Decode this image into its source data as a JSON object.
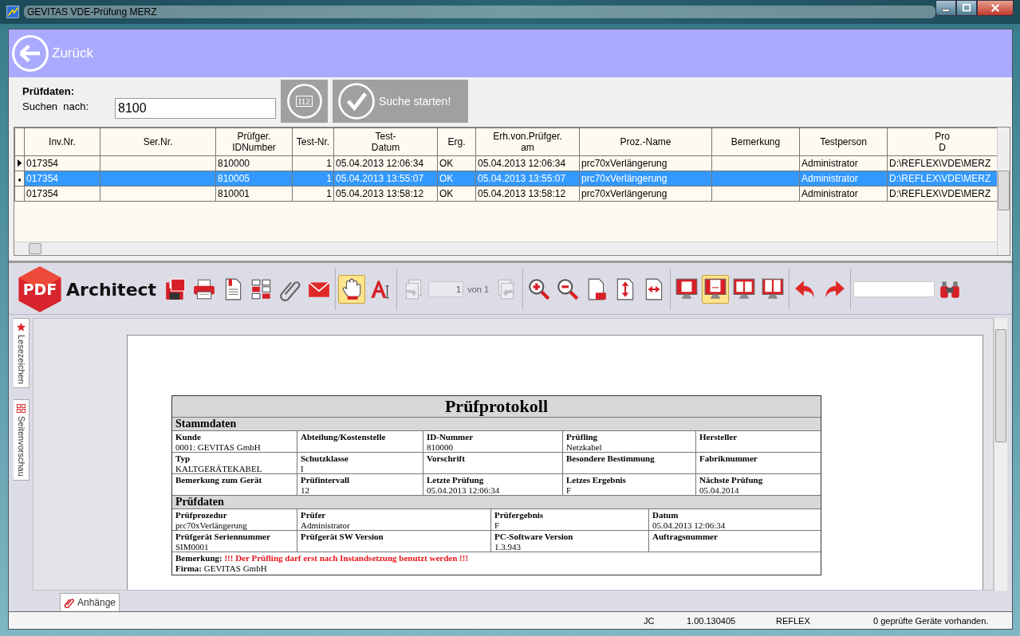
{
  "window": {
    "title": "GEVITAS VDE-Prüfung MERZ"
  },
  "header": {
    "back_label": "Zurück"
  },
  "search": {
    "heading": "Prüfdaten:",
    "label": "Suchen  nach:",
    "value": "8100",
    "id_card_text": "I12",
    "start_label": "Suche starten!"
  },
  "table": {
    "columns": [
      "Inv.Nr.",
      "Ser.Nr.",
      "Prüfger.\nIDNumber",
      "Test-Nr.",
      "Test-\nDatum",
      "Erg.",
      "Erh.von.Prüfger.\nam",
      "Proz.-Name",
      "Bemerkung",
      "Testperson",
      "Pro\nD"
    ],
    "rows": [
      {
        "kind": "current",
        "selected": false,
        "cells": [
          "017354",
          null,
          "810000",
          "1",
          "05.04.2013 12:06:34",
          "OK",
          "05.04.2013 12:06:34",
          "prc70xVerlängerung",
          null,
          "Administrator",
          "D:\\REFLEX\\VDE\\MERZ"
        ]
      },
      {
        "kind": "edited",
        "selected": true,
        "cells": [
          "017354",
          null,
          "810005",
          "1",
          "05.04.2013 13:55:07",
          "OK",
          "05.04.2013 13:55:07",
          "prc70xVerlängerung",
          null,
          "Administrator",
          "D:\\REFLEX\\VDE\\MERZ"
        ]
      },
      {
        "kind": "plain",
        "selected": false,
        "cells": [
          "017354",
          null,
          "810001",
          "1",
          "05.04.2013 13:58:12",
          "OK",
          "05.04.2013 13:58:12",
          "prc70xVerlängerung",
          null,
          "Administrator",
          "D:\\REFLEX\\VDE\\MERZ"
        ]
      }
    ]
  },
  "pdf_toolbar": {
    "logo_badge": "PDF",
    "logo_text": "Architect",
    "groups": [
      [
        {
          "kind": "save",
          "selected": false,
          "disabled": false
        },
        {
          "kind": "print",
          "selected": false,
          "disabled": false
        },
        {
          "kind": "document",
          "selected": false,
          "disabled": false
        },
        {
          "kind": "thumbnails",
          "selected": false,
          "disabled": false
        },
        {
          "kind": "paperclip",
          "selected": false,
          "disabled": false
        },
        {
          "kind": "envelope",
          "selected": false,
          "disabled": false
        }
      ],
      [
        {
          "kind": "hand",
          "selected": true,
          "disabled": false
        },
        {
          "kind": "text-cursor",
          "selected": false,
          "disabled": false
        }
      ],
      [
        {
          "kind": "page-prev",
          "selected": false,
          "disabled": true
        },
        {
          "kind": "page-input",
          "value": "1"
        },
        {
          "kind": "page-label",
          "text": "von 1"
        },
        {
          "kind": "page-next",
          "selected": false,
          "disabled": true
        }
      ],
      [
        {
          "kind": "zoom-in",
          "selected": false,
          "disabled": false
        },
        {
          "kind": "zoom-out",
          "selected": false,
          "disabled": false
        },
        {
          "kind": "fit-page",
          "selected": false,
          "disabled": false
        },
        {
          "kind": "fit-height",
          "selected": false,
          "disabled": false
        },
        {
          "kind": "fit-width",
          "selected": false,
          "disabled": false
        }
      ],
      [
        {
          "kind": "view-single",
          "selected": false,
          "disabled": false
        },
        {
          "kind": "view-continuous",
          "selected": true,
          "disabled": false
        },
        {
          "kind": "view-double",
          "selected": false,
          "disabled": false
        },
        {
          "kind": "view-double-continuous",
          "selected": false,
          "disabled": false
        }
      ],
      [
        {
          "kind": "undo",
          "selected": false,
          "disabled": false
        },
        {
          "kind": "redo",
          "selected": false,
          "disabled": false
        }
      ],
      [
        {
          "kind": "search-input"
        },
        {
          "kind": "binoculars",
          "selected": false,
          "disabled": false
        }
      ]
    ]
  },
  "side_tabs": [
    {
      "kind": "bookmarks",
      "label": "Lesezeichen"
    },
    {
      "kind": "thumbnails",
      "label": "Seitenvorschau"
    }
  ],
  "report": {
    "title": "Prüfprotokoll",
    "sections": [
      {
        "heading": "Stammdaten",
        "rows": [
          [
            {
              "label": "Kunde",
              "value": "0001: GEVITAS GmbH"
            },
            {
              "label": "Abteilung/Kostenstelle"
            },
            {
              "label": "ID-Nummer",
              "value": "810000"
            },
            {
              "label": "Prüfling",
              "value": "Netzkabel"
            },
            {
              "label": "Hersteller"
            }
          ],
          [
            {
              "label": "Typ",
              "value": "KALTGERÄTEKABEL"
            },
            {
              "label": "Schutzklasse",
              "value": "I"
            },
            {
              "label": "Vorschrift"
            },
            {
              "label": "Besondere Bestimmung"
            },
            {
              "label": "Fabriknummer"
            }
          ],
          [
            {
              "label": "Bemerkung zum Gerät"
            },
            {
              "label": "Prüfintervall",
              "value": "12"
            },
            {
              "label": "Letzte Prüfung",
              "value": "05.04.2013 12:06:34"
            },
            {
              "label": "Letzes Ergebnis",
              "value": "F"
            },
            {
              "label": "Nächste Prüfung",
              "value": "05.04.2014"
            }
          ]
        ]
      },
      {
        "heading": "Prüfdaten",
        "rows": [
          [
            {
              "label": "Prüfprozedur",
              "value": "prc70xVerlängerung"
            },
            {
              "label": "Prüfer",
              "value": "Administrator"
            },
            {
              "label": "Prüfergebnis",
              "value": "F"
            },
            {
              "label": "Datum",
              "value": "05.04.2013 12:06:34"
            }
          ],
          [
            {
              "label": "Prüfgerät Seriennummer",
              "value": "SIM0001"
            },
            {
              "label": "Prüfgerät SW Version"
            },
            {
              "label": "PC-Software Version",
              "value": "1.3.943"
            },
            {
              "label": "Auftragsnummer"
            }
          ]
        ]
      }
    ],
    "remark": {
      "label": "Bemerkung:",
      "text": "!!! Der Prüfling darf erst nach Instandsetzung benutzt werden !!!"
    },
    "firm": {
      "label": "Firma:",
      "value": "GEVITAS GmbH"
    }
  },
  "bottom_tabs": [
    {
      "label": "Anhänge"
    }
  ],
  "status_bar": [
    "JC",
    "1.00.130405",
    "REFLEX",
    "0 geprüfte Geräte vorhanden."
  ]
}
